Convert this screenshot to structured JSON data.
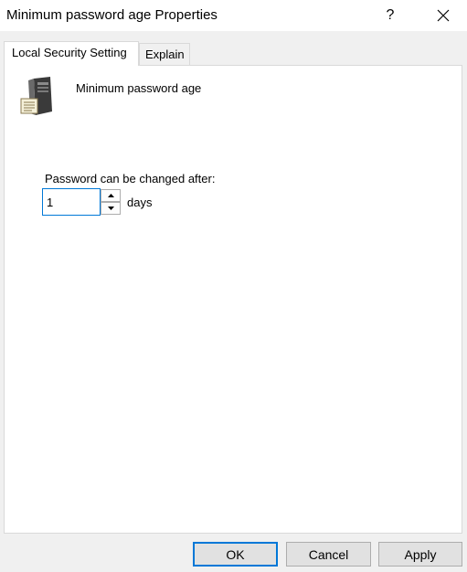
{
  "window": {
    "title": "Minimum password age Properties",
    "help_label": "?",
    "close_icon": "close-icon"
  },
  "tabs": [
    {
      "label": "Local Security Setting",
      "active": true
    },
    {
      "label": "Explain",
      "active": false
    }
  ],
  "setting": {
    "icon": "server-icon",
    "policy_name": "Minimum password age",
    "field_label": "Password can be changed after:",
    "value": "1",
    "units": "days"
  },
  "buttons": {
    "ok": "OK",
    "cancel": "Cancel",
    "apply": "Apply"
  },
  "colors": {
    "accent": "#0078d7",
    "window_bg": "#f0f0f0",
    "panel_bg": "#ffffff"
  }
}
